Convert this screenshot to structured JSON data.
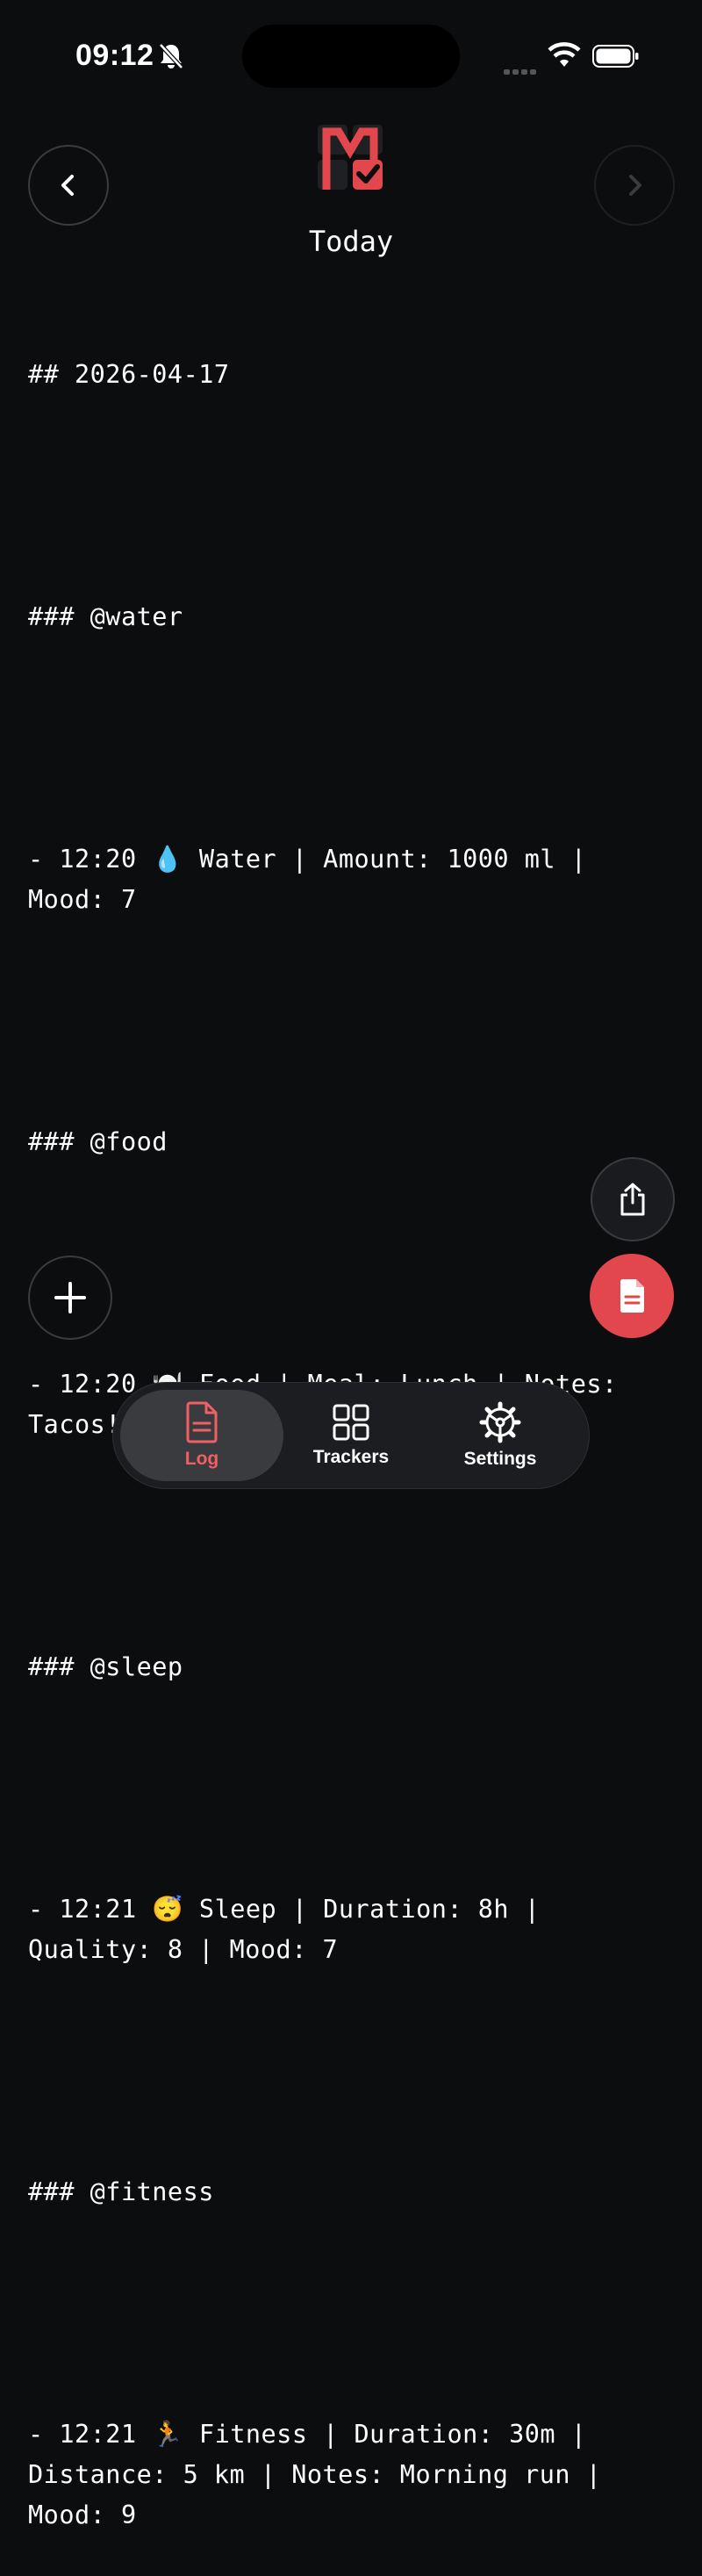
{
  "status_bar": {
    "time": "09:12"
  },
  "header": {
    "title": "Today"
  },
  "log_lines": [
    "## 2026-04-17",
    "",
    "### @water",
    "",
    "- 12:20 💧 Water | Amount: 1000 ml | Mood: 7",
    "",
    "### @food",
    "",
    "- 12:20 🍽️ Food | Meal: Lunch | Notes: Tacos! | Mood: 8",
    "",
    "### @sleep",
    "",
    "- 12:21 😴 Sleep | Duration: 8h | Quality: 8 | Mood: 7",
    "",
    "### @fitness",
    "",
    "- 12:21 🏃 Fitness | Duration: 30m | Distance: 5 km | Notes: Morning run | Mood: 9"
  ],
  "tabbar": {
    "log": "Log",
    "trackers": "Trackers",
    "settings": "Settings"
  },
  "colors": {
    "accent": "#e2474d",
    "background": "#0c0d0f",
    "active_tab_label": "#ef5f63"
  },
  "icons": [
    "bell-slash-icon",
    "wifi-icon",
    "battery-icon",
    "chevron-left-icon",
    "chevron-right-icon",
    "share-icon",
    "document-icon",
    "plus-icon",
    "grid-icon",
    "gear-icon"
  ]
}
